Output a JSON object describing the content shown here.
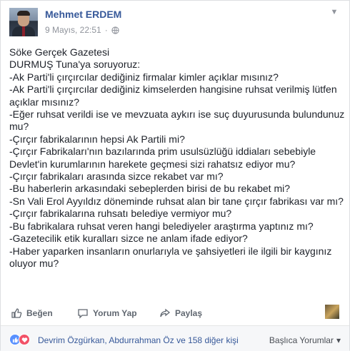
{
  "post": {
    "author": "Mehmet ERDEM",
    "timestamp": "9 Mayıs, 22:51",
    "privacy_sep": "·",
    "lines": [
      "Söke Gerçek Gazetesi",
      "DURMUŞ Tuna'ya soruyoruz:",
      "-Ak Parti'li çırçırcılar dediğiniz firmalar kimler açıklar mısınız?",
      "-Ak Parti'li çırçırcılar dediğiniz kimselerden hangisine ruhsat verilmiş lütfen",
      "açıklar mısınız?",
      "-Eğer ruhsat verildi ise ve mevzuata aykırı ise suç duyurusunda bulundunuz",
      "mu?",
      "-Çırçır fabrikalarının hepsi Ak Partili mi?",
      "-Çırçır Fabrikaları'nın bazılarında prim usulsüzlüğü iddiaları sebebiyle",
      "Devlet'in kurumlarının harekete geçmesi sizi rahatsız ediyor mu?",
      "-Çırçır fabrikaları arasında sizce rekabet var mı?",
      "-Bu haberlerin arkasındaki sebeplerden birisi de bu rekabet mi?",
      "-Sn Vali Erol Ayyıldız döneminde ruhsat alan bir tane çırçır fabrikası var mı?",
      "-Çırçır fabrikalarına ruhsatı belediye vermiyor mu?",
      "-Bu fabrikalara ruhsat veren hangi belediyeler araştırma yaptınız mı?",
      "-Gazetecilik etik kuralları sizce ne anlam ifade ediyor?",
      "-Haber yaparken insanların onurlarıyla ve şahsiyetleri ile ilgili bir kaygınız",
      "oluyor mu?"
    ]
  },
  "actions": {
    "like": "Beğen",
    "comment": "Yorum Yap",
    "share": "Paylaş"
  },
  "footer": {
    "likers": "Devrim Özgürkan, Abdurrahman Öz ve 158 diğer kişi",
    "sort": "Başlıca Yorumlar",
    "sort_caret": "▾"
  },
  "colors": {
    "link": "#365899",
    "like": "#5890ff",
    "love": "#f25268"
  }
}
